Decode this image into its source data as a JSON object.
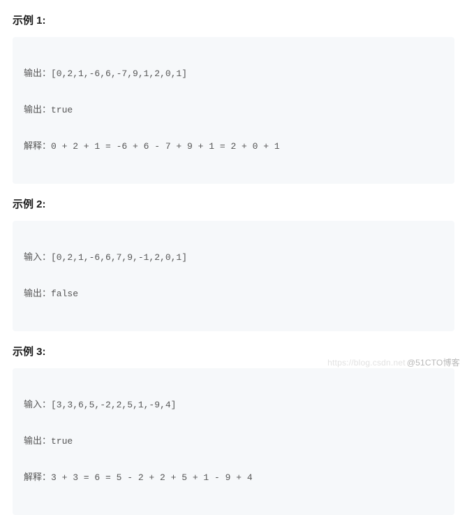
{
  "examples": [
    {
      "title": "示例 1:",
      "lines": [
        "输出：[0,2,1,-6,6,-7,9,1,2,0,1]",
        "输出：true",
        "解释：0 + 2 + 1 = -6 + 6 - 7 + 9 + 1 = 2 + 0 + 1"
      ]
    },
    {
      "title": "示例 2:",
      "lines": [
        "输入：[0,2,1,-6,6,7,9,-1,2,0,1]",
        "输出：false"
      ]
    },
    {
      "title": "示例 3:",
      "lines": [
        "输入：[3,3,6,5,-2,2,5,1,-9,4]",
        "输出：true",
        "解释：3 + 3 = 6 = 5 - 2 + 2 + 5 + 1 - 9 + 4"
      ]
    }
  ],
  "watermark": {
    "faint": "https://blog.csdn.net",
    "main": "@51CTO博客"
  }
}
